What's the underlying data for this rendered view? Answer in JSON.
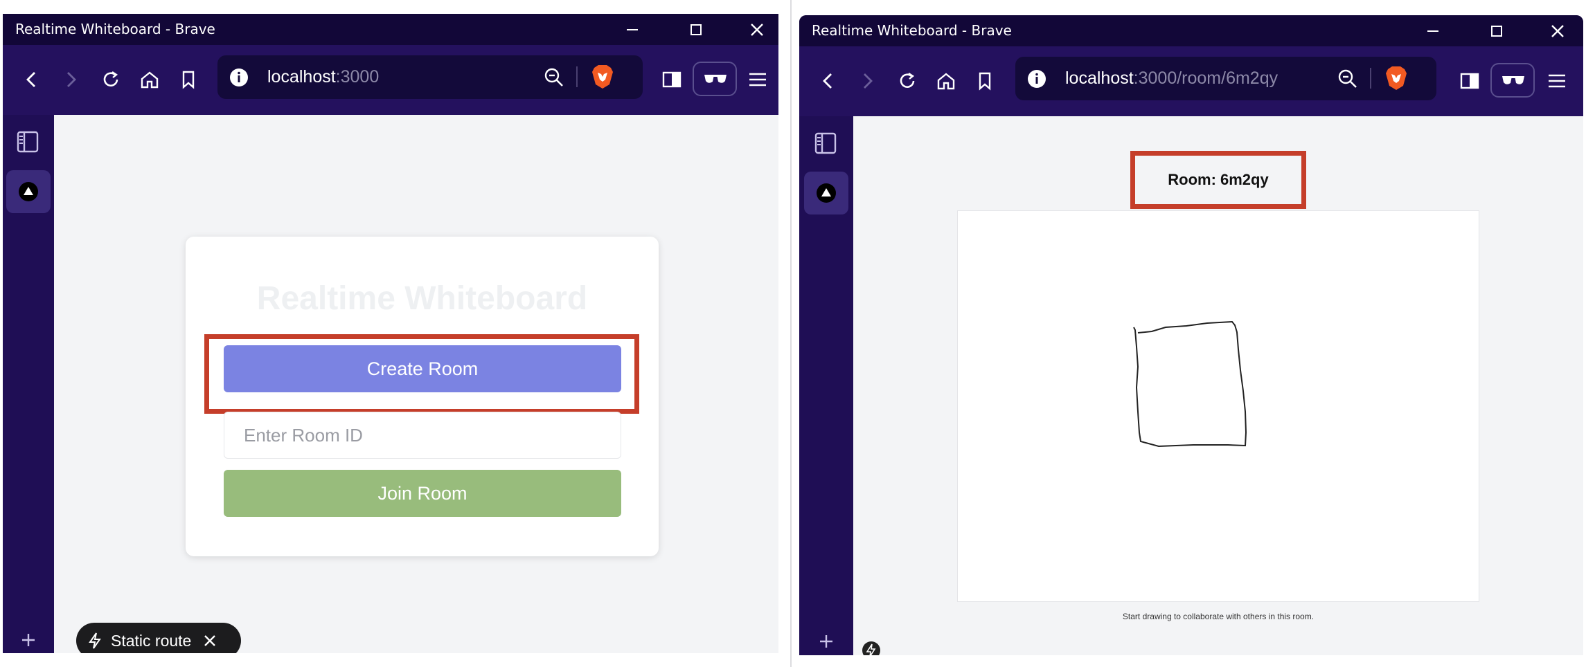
{
  "left": {
    "window_title": "Realtime Whiteboard - Brave",
    "url_host": "localhost",
    "url_rest": ":3000",
    "app_title": "Realtime Whiteboard",
    "create_button": "Create Room",
    "room_input_placeholder": "Enter Room ID",
    "join_button": "Join Room",
    "route_badge": "Static route"
  },
  "right": {
    "window_title": "Realtime Whiteboard - Brave",
    "url_host": "localhost",
    "url_rest": ":3000/room/6m2qy",
    "room_label": "Room: 6m2qy",
    "hint": "Start drawing to collaborate with others in this room."
  },
  "colors": {
    "create_button": "#7b83e2",
    "join_button": "#98bc7c",
    "highlight": "#c53e2a",
    "titlebar": "#120738",
    "toolbar": "#24115e"
  }
}
